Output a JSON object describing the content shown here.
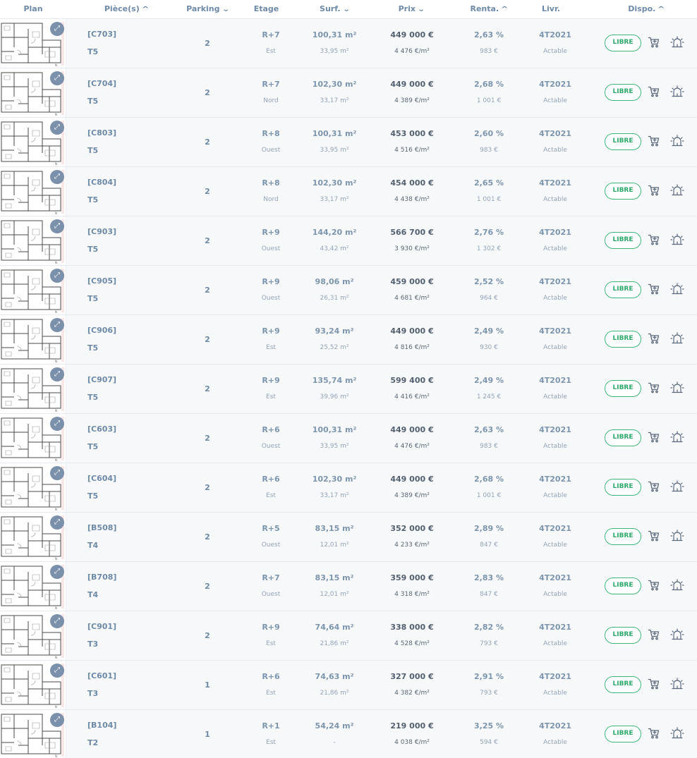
{
  "header": {
    "plan": "Plan",
    "pieces": "Pièce(s)",
    "parking": "Parking",
    "etage": "Etage",
    "surf": "Surf.",
    "prix": "Prix",
    "renta": "Renta.",
    "livr": "Livr.",
    "dispo": "Dispo."
  },
  "sort_icons": {
    "pieces": "chevron-up-icon",
    "parking": "chevron-down-icon",
    "surf": "chevron-down-icon",
    "prix": "chevron-down-icon",
    "renta": "chevron-up-icon",
    "dispo": "chevron-up-icon"
  },
  "colors": {
    "accent_text": "#6e8aa6",
    "price_text": "#53606f",
    "available_green": "#2fa96b",
    "row_bg": "#f7f8fa",
    "zoom_badge": "#7b90aa"
  },
  "lots": [
    {
      "ref": "[C703]",
      "type": "T5",
      "parking": "2",
      "etage": "R+7",
      "orientation": "Est",
      "surface": "100,31 m²",
      "surface_ext": "33,95 m²",
      "prix": "449 000 €",
      "prix_m2": "4 476 €/m²",
      "renta": "2,63 %",
      "loyer": "983 €",
      "livraison": "4T2021",
      "fiscal": "Actable",
      "dispo": "LIBRE"
    },
    {
      "ref": "[C704]",
      "type": "T5",
      "parking": "2",
      "etage": "R+7",
      "orientation": "Nord",
      "surface": "102,30 m²",
      "surface_ext": "33,17 m²",
      "prix": "449 000 €",
      "prix_m2": "4 389 €/m²",
      "renta": "2,68 %",
      "loyer": "1 001 €",
      "livraison": "4T2021",
      "fiscal": "Actable",
      "dispo": "LIBRE"
    },
    {
      "ref": "[C803]",
      "type": "T5",
      "parking": "2",
      "etage": "R+8",
      "orientation": "Ouest",
      "surface": "100,31 m²",
      "surface_ext": "33,95 m²",
      "prix": "453 000 €",
      "prix_m2": "4 516 €/m²",
      "renta": "2,60 %",
      "loyer": "983 €",
      "livraison": "4T2021",
      "fiscal": "Actable",
      "dispo": "LIBRE"
    },
    {
      "ref": "[C804]",
      "type": "T5",
      "parking": "2",
      "etage": "R+8",
      "orientation": "Nord",
      "surface": "102,30 m²",
      "surface_ext": "33,17 m²",
      "prix": "454 000 €",
      "prix_m2": "4 438 €/m²",
      "renta": "2,65 %",
      "loyer": "1 001 €",
      "livraison": "4T2021",
      "fiscal": "Actable",
      "dispo": "LIBRE"
    },
    {
      "ref": "[C903]",
      "type": "T5",
      "parking": "2",
      "etage": "R+9",
      "orientation": "Ouest",
      "surface": "144,20 m²",
      "surface_ext": "43,42 m²",
      "prix": "566 700 €",
      "prix_m2": "3 930 €/m²",
      "renta": "2,76 %",
      "loyer": "1 302 €",
      "livraison": "4T2021",
      "fiscal": "Actable",
      "dispo": "LIBRE"
    },
    {
      "ref": "[C905]",
      "type": "T5",
      "parking": "2",
      "etage": "R+9",
      "orientation": "Ouest",
      "surface": "98,06 m²",
      "surface_ext": "26,31 m²",
      "prix": "459 000 €",
      "prix_m2": "4 681 €/m²",
      "renta": "2,52 %",
      "loyer": "964 €",
      "livraison": "4T2021",
      "fiscal": "Actable",
      "dispo": "LIBRE"
    },
    {
      "ref": "[C906]",
      "type": "T5",
      "parking": "2",
      "etage": "R+9",
      "orientation": "Est",
      "surface": "93,24 m²",
      "surface_ext": "25,52 m²",
      "prix": "449 000 €",
      "prix_m2": "4 816 €/m²",
      "renta": "2,49 %",
      "loyer": "930 €",
      "livraison": "4T2021",
      "fiscal": "Actable",
      "dispo": "LIBRE"
    },
    {
      "ref": "[C907]",
      "type": "T5",
      "parking": "2",
      "etage": "R+9",
      "orientation": "Est",
      "surface": "135,74 m²",
      "surface_ext": "39,96 m²",
      "prix": "599 400 €",
      "prix_m2": "4 416 €/m²",
      "renta": "2,49 %",
      "loyer": "1 245 €",
      "livraison": "4T2021",
      "fiscal": "Actable",
      "dispo": "LIBRE"
    },
    {
      "ref": "[C603]",
      "type": "T5",
      "parking": "2",
      "etage": "R+6",
      "orientation": "Ouest",
      "surface": "100,31 m²",
      "surface_ext": "33,95 m²",
      "prix": "449 000 €",
      "prix_m2": "4 476 €/m²",
      "renta": "2,63 %",
      "loyer": "983 €",
      "livraison": "4T2021",
      "fiscal": "Actable",
      "dispo": "LIBRE"
    },
    {
      "ref": "[C604]",
      "type": "T5",
      "parking": "2",
      "etage": "R+6",
      "orientation": "Est",
      "surface": "102,30 m²",
      "surface_ext": "33,17 m²",
      "prix": "449 000 €",
      "prix_m2": "4 389 €/m²",
      "renta": "2,68 %",
      "loyer": "1 001 €",
      "livraison": "4T2021",
      "fiscal": "Actable",
      "dispo": "LIBRE"
    },
    {
      "ref": "[B508]",
      "type": "T4",
      "parking": "2",
      "etage": "R+5",
      "orientation": "Ouest",
      "surface": "83,15 m²",
      "surface_ext": "12,01 m²",
      "prix": "352 000 €",
      "prix_m2": "4 233 €/m²",
      "renta": "2,89 %",
      "loyer": "847 €",
      "livraison": "4T2021",
      "fiscal": "Actable",
      "dispo": "LIBRE"
    },
    {
      "ref": "[B708]",
      "type": "T4",
      "parking": "2",
      "etage": "R+7",
      "orientation": "Ouest",
      "surface": "83,15 m²",
      "surface_ext": "12,01 m²",
      "prix": "359 000 €",
      "prix_m2": "4 318 €/m²",
      "renta": "2,83 %",
      "loyer": "847 €",
      "livraison": "4T2021",
      "fiscal": "Actable",
      "dispo": "LIBRE"
    },
    {
      "ref": "[C901]",
      "type": "T3",
      "parking": "2",
      "etage": "R+9",
      "orientation": "Est",
      "surface": "74,64 m²",
      "surface_ext": "21,86 m²",
      "prix": "338 000 €",
      "prix_m2": "4 528 €/m²",
      "renta": "2,82 %",
      "loyer": "793 €",
      "livraison": "4T2021",
      "fiscal": "Actable",
      "dispo": "LIBRE"
    },
    {
      "ref": "[C601]",
      "type": "T3",
      "parking": "1",
      "etage": "R+6",
      "orientation": "Est",
      "surface": "74,63 m²",
      "surface_ext": "21,86 m²",
      "prix": "327 000 €",
      "prix_m2": "4 382 €/m²",
      "renta": "2,91 %",
      "loyer": "793 €",
      "livraison": "4T2021",
      "fiscal": "Actable",
      "dispo": "LIBRE"
    },
    {
      "ref": "[B104]",
      "type": "T2",
      "parking": "1",
      "etage": "R+1",
      "orientation": "Est",
      "surface": "54,24 m²",
      "surface_ext": "-",
      "prix": "219 000 €",
      "prix_m2": "4 038 €/m²",
      "renta": "3,25 %",
      "loyer": "594 €",
      "livraison": "4T2021",
      "fiscal": "Actable",
      "dispo": "LIBRE"
    }
  ]
}
